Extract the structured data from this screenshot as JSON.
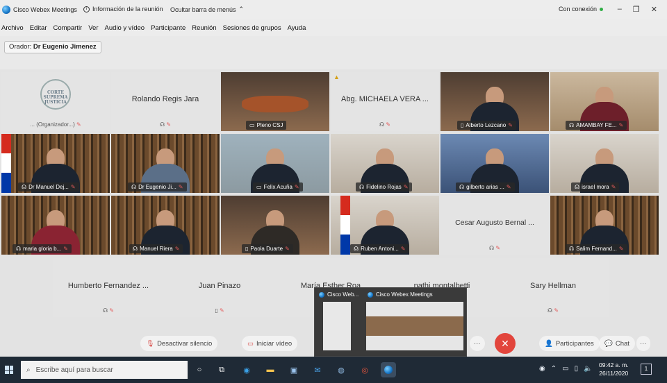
{
  "window": {
    "app_title": "Cisco Webex Meetings",
    "meeting_info": "Información de la reunión",
    "hide_menu": "Ocultar barra de menús",
    "connection": "Con conexión",
    "controls": [
      "–",
      "❐",
      "✕"
    ]
  },
  "menu": [
    "Archivo",
    "Editar",
    "Compartir",
    "Ver",
    "Audio y vídeo",
    "Participante",
    "Reunión",
    "Sesiones de grupos",
    "Ayuda"
  ],
  "speaker": {
    "label": "Orador:",
    "name": "Dr Eugenio Jimenez"
  },
  "tiles": [
    {
      "name": "... (Organizador...)",
      "sub": "",
      "type": "avatar",
      "seal": "CORTE SUPREMA JUSTICIA"
    },
    {
      "name": "Rolando Regis Jara",
      "type": "avatar"
    },
    {
      "name": "Pleno CSJ",
      "type": "video"
    },
    {
      "name": "Abg. MICHAELA VERA ...",
      "type": "avatar"
    },
    {
      "name": "Alberto Lezcano",
      "type": "video"
    },
    {
      "name": "AMAMBAY FE...",
      "type": "video"
    },
    {
      "name": "Dr Manuel Dej...",
      "type": "video"
    },
    {
      "name": "Dr Eugenio Ji...",
      "type": "video"
    },
    {
      "name": "Felix Acuña",
      "type": "video"
    },
    {
      "name": "Fidelino Rojas",
      "type": "video"
    },
    {
      "name": "gilberto arias ...",
      "type": "video"
    },
    {
      "name": "israel mora",
      "type": "video"
    },
    {
      "name": "maria gloria b...",
      "type": "video"
    },
    {
      "name": "Manuel Riera",
      "type": "video"
    },
    {
      "name": "Paola Duarte",
      "type": "video"
    },
    {
      "name": "Ruben Antoni...",
      "type": "video"
    },
    {
      "name": "Cesar Augusto Bernal ...",
      "type": "avatar"
    },
    {
      "name": "Salim Fernand...",
      "type": "video"
    },
    {
      "name": "Humberto Fernandez ...",
      "type": "avatar"
    },
    {
      "name": "Juan Pinazo",
      "type": "avatar"
    },
    {
      "name": "María Esther Roa",
      "type": "avatar"
    },
    {
      "name": "nathi montalbetti",
      "type": "avatar"
    },
    {
      "name": "Sary Hellman",
      "type": "avatar"
    }
  ],
  "controls": {
    "mute": "Desactivar silencio",
    "video": "Iniciar vídeo",
    "more": "···",
    "end": "✕",
    "participants": "Participantes",
    "chat": "Chat",
    "more2": "···"
  },
  "preview": {
    "item1": "Cisco Web...",
    "item2": "Cisco Webex Meetings"
  },
  "taskbar": {
    "search_placeholder": "Escribe aquí para buscar",
    "time": "09:42 a. m.",
    "date": "26/11/2020",
    "notifications": "1"
  }
}
